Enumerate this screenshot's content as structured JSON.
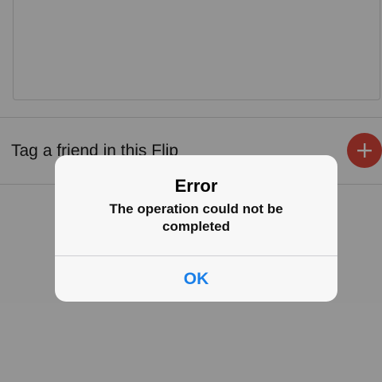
{
  "compose": {
    "tag_label": "Tag a friend in this Flip"
  },
  "icons": {
    "add": "plus-icon"
  },
  "alert": {
    "title": "Error",
    "message": "The operation could not be completed",
    "ok_label": "OK"
  },
  "colors": {
    "add_button": "#d9453a",
    "ok_text": "#1a7fe8"
  }
}
